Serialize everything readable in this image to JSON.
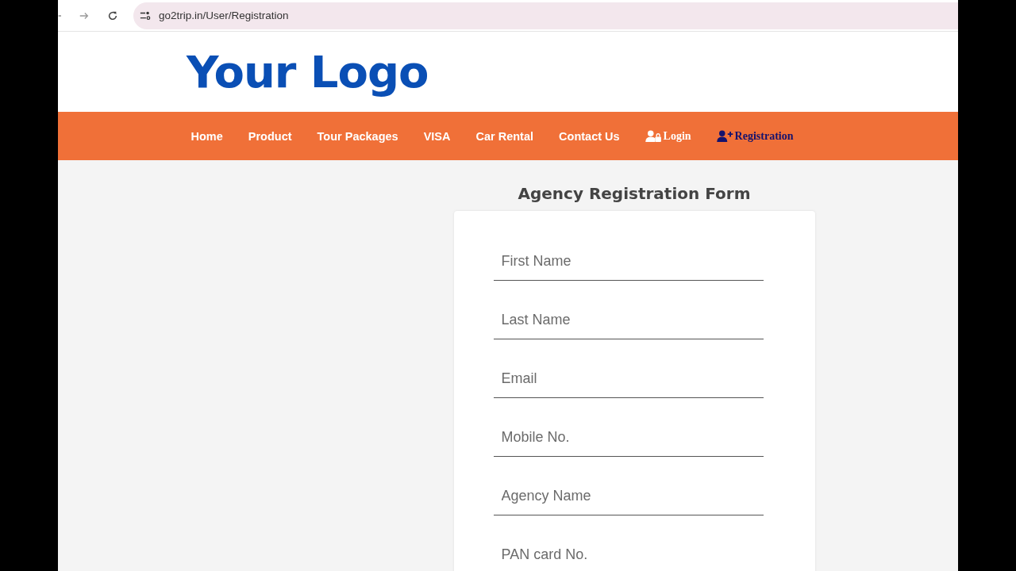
{
  "browser": {
    "url": "go2trip.in/User/Registration"
  },
  "header": {
    "logo": "Your Logo"
  },
  "nav": [
    {
      "label": "Home",
      "kind": "plain",
      "selected": false
    },
    {
      "label": "Product",
      "kind": "plain",
      "selected": false
    },
    {
      "label": "Tour Packages",
      "kind": "plain",
      "selected": false
    },
    {
      "label": "VISA",
      "kind": "plain",
      "selected": false
    },
    {
      "label": "Car Rental",
      "kind": "plain",
      "selected": false
    },
    {
      "label": "Contact Us",
      "kind": "plain",
      "selected": false
    },
    {
      "label": "Login",
      "kind": "lock",
      "selected": false
    },
    {
      "label": "Registration",
      "kind": "add",
      "selected": true
    }
  ],
  "form": {
    "title": "Agency Registration Form",
    "fields": [
      {
        "placeholder": "First Name"
      },
      {
        "placeholder": "Last Name"
      },
      {
        "placeholder": "Email"
      },
      {
        "placeholder": "Mobile No."
      },
      {
        "placeholder": "Agency Name"
      },
      {
        "placeholder": "PAN card No."
      }
    ]
  }
}
